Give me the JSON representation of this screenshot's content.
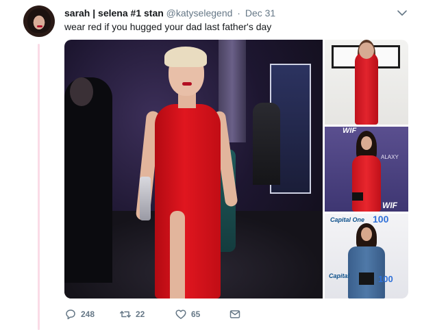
{
  "tweet": {
    "display_name": "sarah | selena #1 stan",
    "handle": "@katyselegend",
    "separator": "·",
    "time": "Dec 31",
    "text": "wear red if you hugged your dad last father's day"
  },
  "media": {
    "side_photos": {
      "photo_2_top_sign": "WIF",
      "photo_2_bottom_sign": "WIF",
      "photo_2_side_text": "ALAXY",
      "photo_3_brand_top": "Capital One",
      "photo_3_logo_top": "100",
      "photo_3_brand_bottom": "Capital",
      "photo_3_logo_bottom": "100"
    }
  },
  "actions": {
    "reply_count": "248",
    "retweet_count": "22",
    "like_count": "65"
  },
  "icons": [
    "avatar",
    "chevron-down-icon",
    "reply-icon",
    "retweet-icon",
    "heart-icon",
    "mail-icon"
  ],
  "colors": {
    "thread_line": "#fadbe6",
    "secondary_text": "#657786",
    "primary_text": "#14171a"
  }
}
